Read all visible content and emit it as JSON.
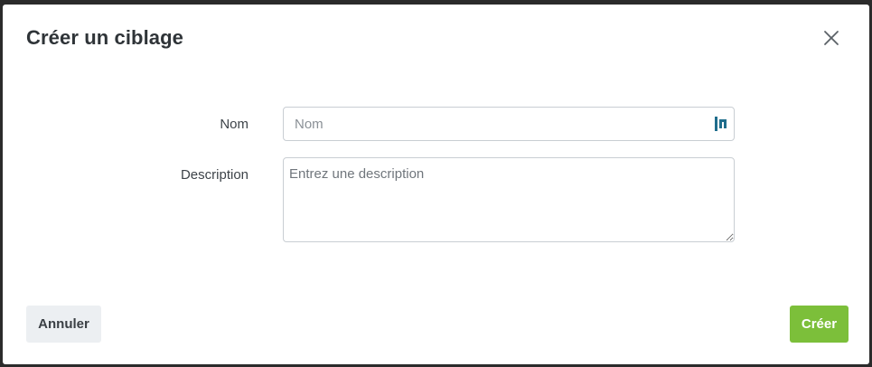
{
  "dialog": {
    "title": "Créer un ciblage"
  },
  "form": {
    "name": {
      "label": "Nom",
      "placeholder": "Nom",
      "value": "",
      "icon": "password-manager-icon"
    },
    "description": {
      "label": "Description",
      "placeholder": "Entrez une description",
      "value": ""
    }
  },
  "footer": {
    "cancel_label": "Annuler",
    "create_label": "Créer"
  },
  "colors": {
    "primary_button": "#7cbf3a",
    "secondary_button": "#eceff2",
    "icon_accent": "#1f6d8c"
  }
}
